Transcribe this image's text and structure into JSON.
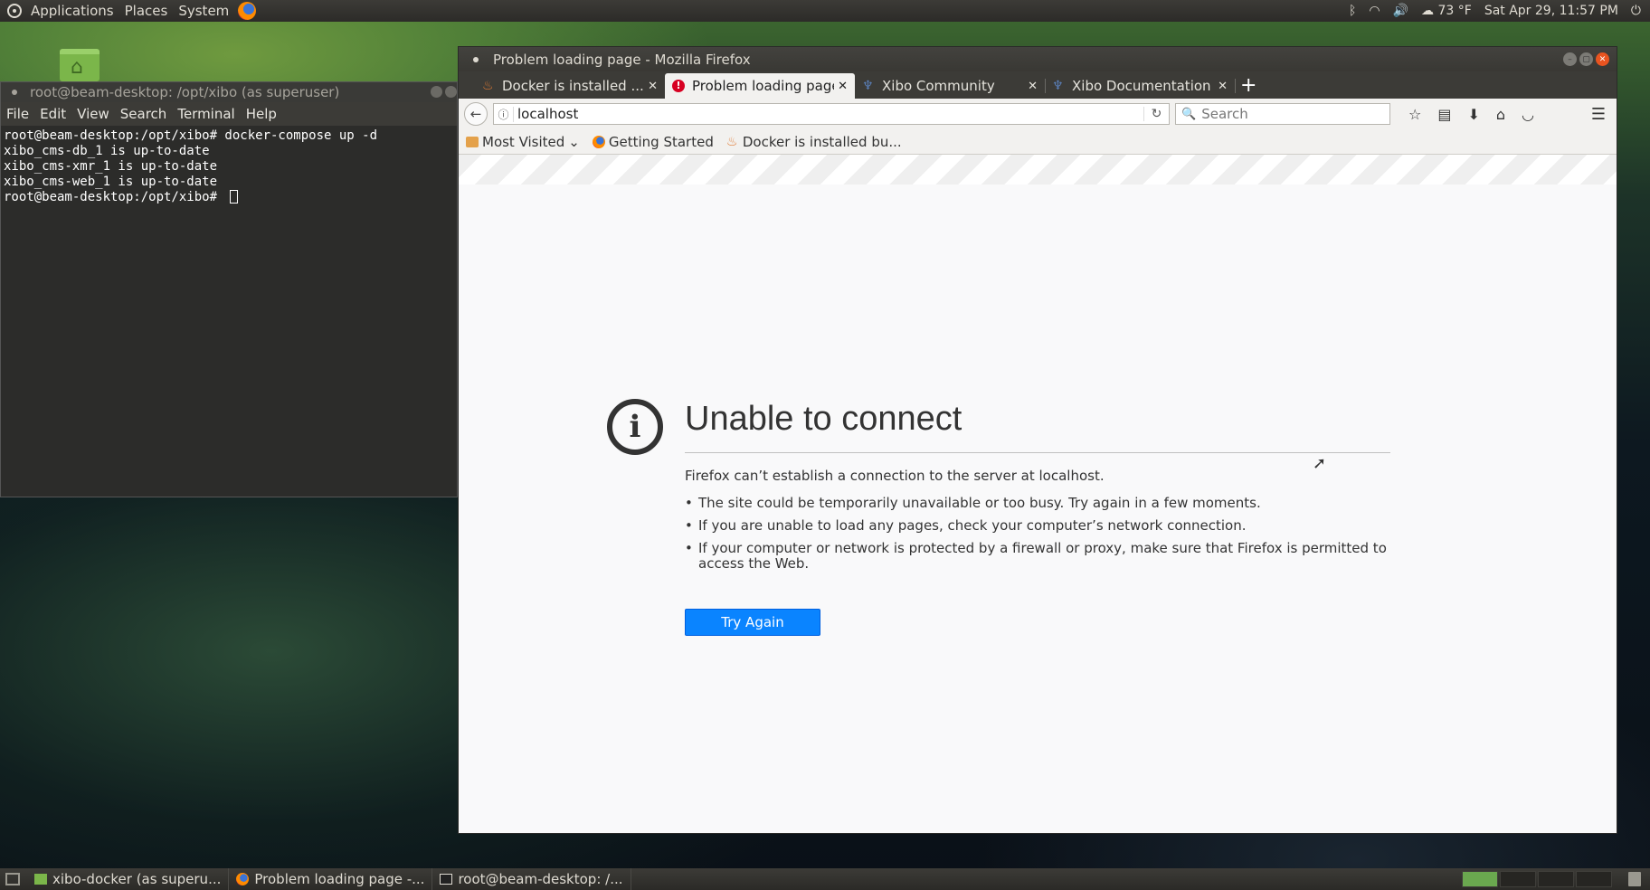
{
  "top_panel": {
    "menus": [
      "Applications",
      "Places",
      "System"
    ],
    "weather": "73 °F",
    "clock": "Sat Apr 29, 11:57 PM"
  },
  "terminal": {
    "title": "root@beam-desktop: /opt/xibo (as superuser)",
    "menu": [
      "File",
      "Edit",
      "View",
      "Search",
      "Terminal",
      "Help"
    ],
    "lines": [
      "root@beam-desktop:/opt/xibo# docker-compose up -d",
      "xibo_cms-db_1 is up-to-date",
      "xibo_cms-xmr_1 is up-to-date",
      "xibo_cms-web_1 is up-to-date",
      "root@beam-desktop:/opt/xibo# "
    ]
  },
  "firefox": {
    "title": "Problem loading page - Mozilla Firefox",
    "tabs": [
      {
        "label": "Docker is installed ...",
        "icon": "docker-icon"
      },
      {
        "label": "Problem loading page",
        "icon": "error-icon"
      },
      {
        "label": "Xibo Community",
        "icon": "xibo-icon"
      },
      {
        "label": "Xibo Documentation",
        "icon": "xibo-icon"
      }
    ],
    "url": "localhost",
    "search_placeholder": "Search",
    "bookmarks": [
      "Most Visited",
      "Getting Started",
      "Docker is installed bu..."
    ],
    "error": {
      "title": "Unable to connect",
      "description": "Firefox can’t establish a connection to the server at localhost.",
      "bullets": [
        "The site could be temporarily unavailable or too busy. Try again in a few moments.",
        "If you are unable to load any pages, check your computer’s network connection.",
        "If your computer or network is protected by a firewall or proxy, make sure that Firefox is permitted to access the Web."
      ],
      "button": "Try Again"
    }
  },
  "taskbar": {
    "items": [
      {
        "label": "xibo-docker (as superu...",
        "icon": "folder-icon"
      },
      {
        "label": "Problem loading page -...",
        "icon": "firefox-icon"
      },
      {
        "label": "root@beam-desktop: /...",
        "icon": "terminal-icon"
      }
    ]
  },
  "colors": {
    "accent": "#0a84ff",
    "ubuntu_orange": "#e95420"
  }
}
